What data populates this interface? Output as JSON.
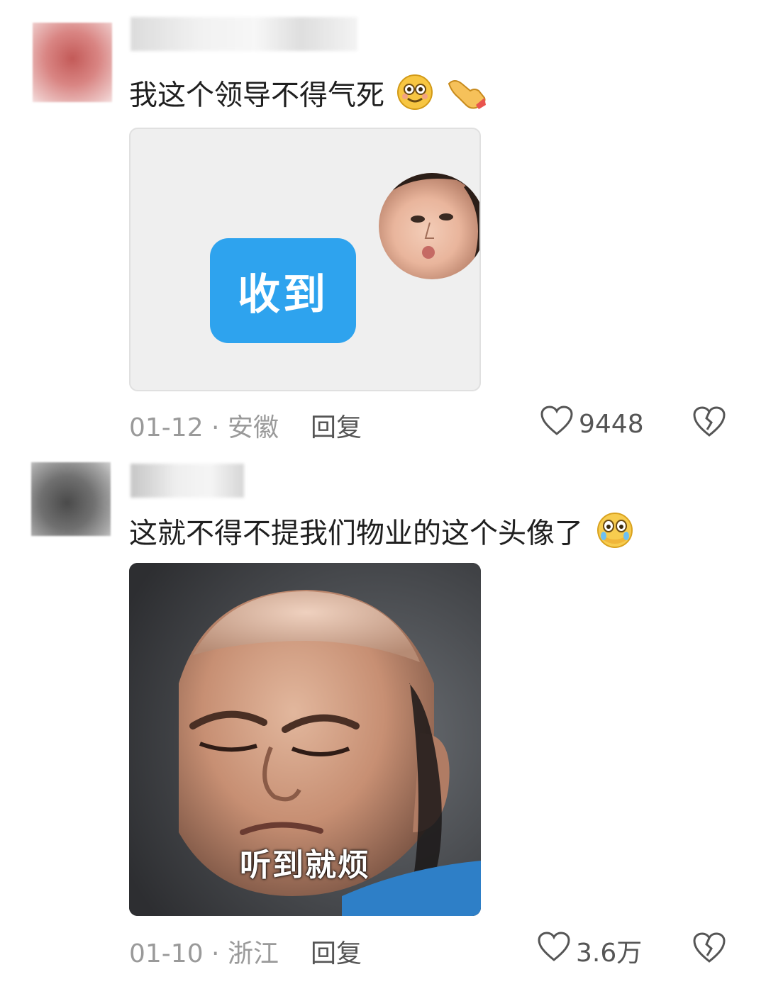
{
  "comments": [
    {
      "text": "我这个领导不得气死",
      "image_button_label": "收到",
      "date_location": "01-12 · 安徽",
      "reply_label": "回复",
      "likes": "9448"
    },
    {
      "text": "这就不得不提我们物业的这个头像了",
      "image_caption": "听到就烦",
      "date_location": "01-10 · 浙江",
      "reply_label": "回复",
      "likes": "3.6万"
    }
  ],
  "icons": {
    "like": "heart-outline-icon",
    "dislike": "broken-heart-icon"
  }
}
